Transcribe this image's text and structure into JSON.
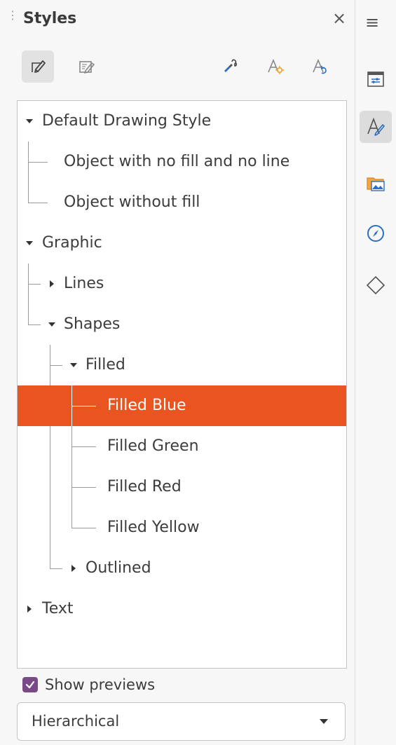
{
  "panel": {
    "title": "Styles",
    "close_glyph": "×"
  },
  "toolbar": {
    "buttons": [
      {
        "name": "drawing-styles",
        "icon": "drawing-styles-icon",
        "active": true
      },
      {
        "name": "presentation-styles",
        "icon": "presentation-styles-icon",
        "active": false
      },
      {
        "name": "fill-format-mode",
        "icon": "fill-format-mode-icon",
        "active": false
      },
      {
        "name": "new-style-from-selection",
        "icon": "new-style-icon",
        "active": false
      },
      {
        "name": "update-style",
        "icon": "update-style-icon",
        "active": false
      }
    ]
  },
  "tree": {
    "items": [
      {
        "label": "Default Drawing Style",
        "expanded": true,
        "selected": false
      },
      {
        "label": "Object with no fill and no line",
        "selected": false
      },
      {
        "label": "Object without fill",
        "selected": false
      },
      {
        "label": "Graphic",
        "expanded": true,
        "selected": false
      },
      {
        "label": "Lines",
        "expanded": false,
        "selected": false
      },
      {
        "label": "Shapes",
        "expanded": true,
        "selected": false
      },
      {
        "label": "Filled",
        "expanded": true,
        "selected": false
      },
      {
        "label": "Filled Blue",
        "selected": true
      },
      {
        "label": "Filled Green",
        "selected": false
      },
      {
        "label": "Filled Red",
        "selected": false
      },
      {
        "label": "Filled Yellow",
        "selected": false
      },
      {
        "label": "Outlined",
        "expanded": false,
        "selected": false
      },
      {
        "label": "Text",
        "expanded": false,
        "selected": false
      }
    ]
  },
  "show_previews": {
    "label": "Show previews",
    "checked": true
  },
  "filter": {
    "value": "Hierarchical"
  },
  "sidebar": {
    "menu_glyph": "≡",
    "buttons": [
      {
        "name": "properties",
        "icon": "properties-icon",
        "active": false
      },
      {
        "name": "styles",
        "icon": "styles-icon",
        "active": true
      },
      {
        "name": "gallery",
        "icon": "gallery-icon",
        "active": false
      },
      {
        "name": "navigator",
        "icon": "navigator-icon",
        "active": false
      },
      {
        "name": "shapes",
        "icon": "shapes-icon",
        "active": false
      }
    ]
  },
  "colors": {
    "selection": "#e95420",
    "checkbox": "#7a4a88",
    "accent_blue": "#2d6fbf"
  }
}
